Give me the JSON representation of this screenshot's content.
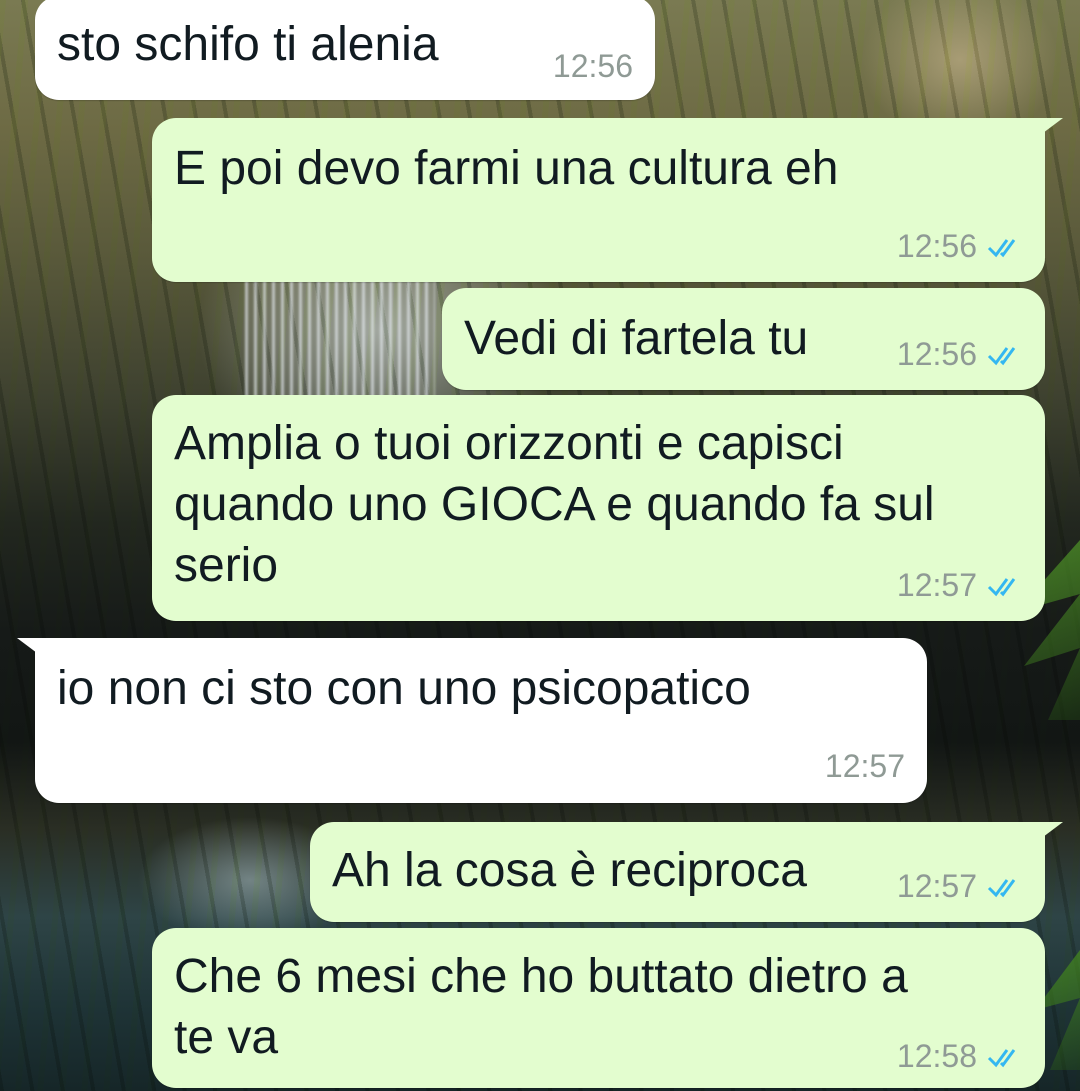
{
  "theme": {
    "incoming_bubble": "#ffffff",
    "outgoing_bubble": "#e3fdcf",
    "text_color": "#111b21",
    "time_color": "#8f9a95",
    "read_ticks_color": "#34b7f1"
  },
  "messages": [
    {
      "direction": "incoming",
      "text": "sto schifo ti alenia",
      "time": "12:56"
    },
    {
      "direction": "outgoing",
      "text": "E poi devo farmi una cultura eh",
      "time": "12:56",
      "status": "read-ticks-icon"
    },
    {
      "direction": "outgoing",
      "text": "Vedi di fartela tu",
      "time": "12:56",
      "status": "read-ticks-icon"
    },
    {
      "direction": "outgoing",
      "text": "Amplia o tuoi orizzonti e capisci\nquando uno GIOCA e quando fa sul\nserio",
      "time": "12:57",
      "status": "read-ticks-icon"
    },
    {
      "direction": "incoming",
      "text": "io non ci sto con uno psicopatico",
      "time": "12:57"
    },
    {
      "direction": "outgoing",
      "text": "Ah la cosa è reciproca",
      "time": "12:57",
      "status": "read-ticks-icon"
    },
    {
      "direction": "outgoing",
      "text": "Che 6 mesi che ho buttato dietro a\nte va",
      "time": "12:58",
      "status": "read-ticks-icon"
    }
  ]
}
